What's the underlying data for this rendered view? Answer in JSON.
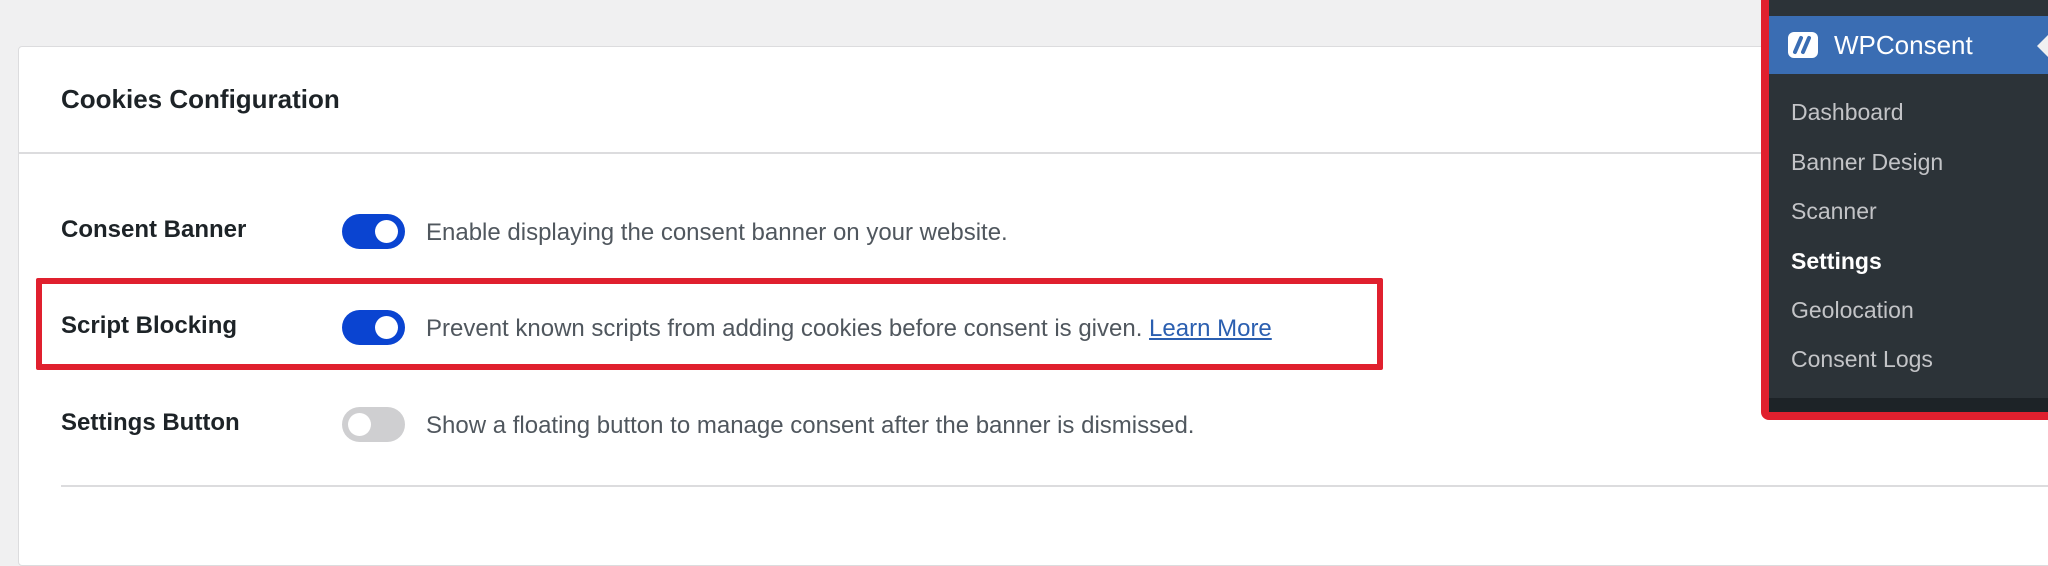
{
  "card": {
    "title": "Cookies Configuration"
  },
  "settings": [
    {
      "label": "Consent Banner",
      "enabled": true,
      "description": "Enable displaying the consent banner on your website.",
      "link": ""
    },
    {
      "label": "Script Blocking",
      "enabled": true,
      "description": "Prevent known scripts from adding cookies before consent is given.",
      "link": "Learn More"
    },
    {
      "label": "Settings Button",
      "enabled": false,
      "description": "Show a floating button to manage consent after the banner is dismissed.",
      "link": ""
    }
  ],
  "sidebar": {
    "title": "WPConsent",
    "logo_icon": "wpconsent-logo-icon",
    "items": [
      {
        "label": "Dashboard",
        "active": false
      },
      {
        "label": "Banner Design",
        "active": false
      },
      {
        "label": "Scanner",
        "active": false
      },
      {
        "label": "Settings",
        "active": true
      },
      {
        "label": "Geolocation",
        "active": false
      },
      {
        "label": "Consent Logs",
        "active": false
      }
    ]
  },
  "colors": {
    "toggle_on": "#0a44d1",
    "toggle_off": "#cfcfd1",
    "highlight": "#e0202e",
    "sidebar_header": "#3a6db3",
    "sidebar_bg": "#2c3338",
    "link": "#2b5fb0"
  }
}
